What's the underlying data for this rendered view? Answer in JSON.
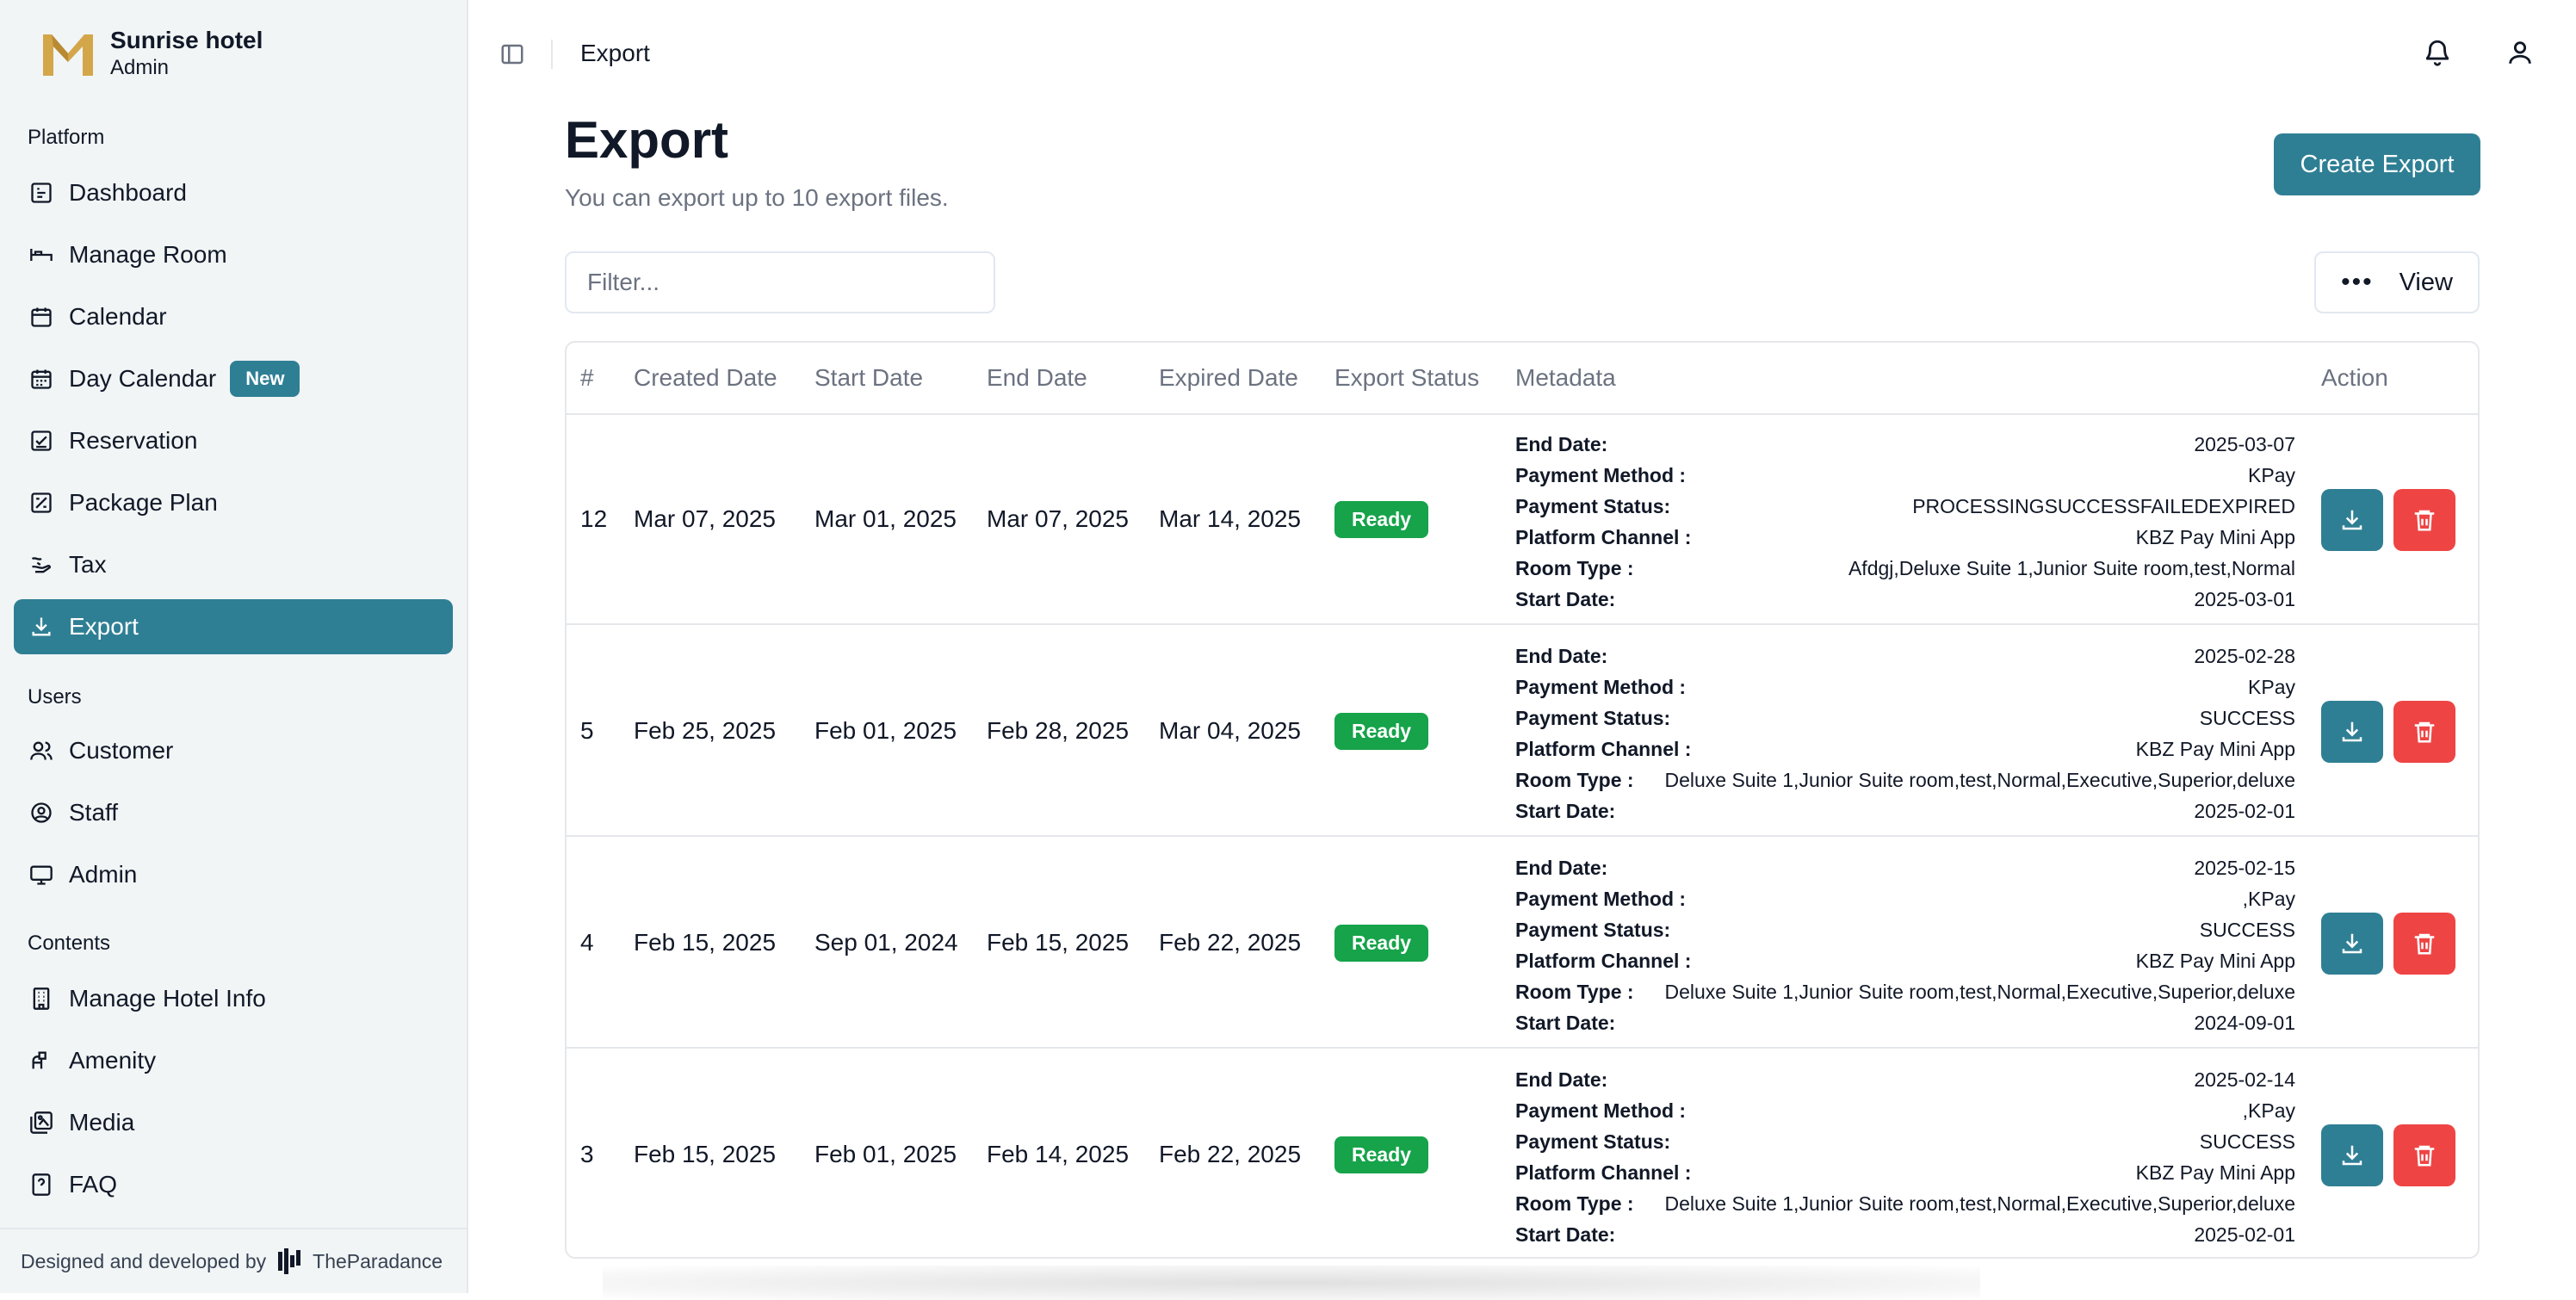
{
  "brand": {
    "title": "Sunrise hotel",
    "subtitle": "Admin"
  },
  "sidebar": {
    "groups": [
      {
        "label": "Platform"
      },
      {
        "label": "Users"
      },
      {
        "label": "Contents"
      }
    ],
    "items": [
      {
        "label": "Dashboard",
        "icon": "dashboard-icon"
      },
      {
        "label": "Manage Room",
        "icon": "bed-icon"
      },
      {
        "label": "Calendar",
        "icon": "calendar-icon"
      },
      {
        "label": "Day Calendar",
        "icon": "calendar-days-icon",
        "badge": "New"
      },
      {
        "label": "Reservation",
        "icon": "reservation-icon"
      },
      {
        "label": "Package Plan",
        "icon": "package-icon"
      },
      {
        "label": "Tax",
        "icon": "tax-icon"
      },
      {
        "label": "Export",
        "icon": "download-icon",
        "active": true
      },
      {
        "label": "Customer",
        "icon": "users-icon"
      },
      {
        "label": "Staff",
        "icon": "user-circle-icon"
      },
      {
        "label": "Admin",
        "icon": "monitor-icon"
      },
      {
        "label": "Manage Hotel Info",
        "icon": "building-icon"
      },
      {
        "label": "Amenity",
        "icon": "amenity-icon"
      },
      {
        "label": "Media",
        "icon": "media-icon"
      },
      {
        "label": "FAQ",
        "icon": "faq-icon"
      }
    ],
    "footer": {
      "text": "Designed and developed by",
      "company": "TheParadance"
    }
  },
  "topbar": {
    "breadcrumb": "Export"
  },
  "page": {
    "title": "Export",
    "subtitle": "You can export up to 10 export files.",
    "create_label": "Create Export",
    "filter_placeholder": "Filter...",
    "view_label": "View"
  },
  "table": {
    "headers": [
      "#",
      "Created Date",
      "Start Date",
      "End Date",
      "Expired Date",
      "Export Status",
      "Metadata",
      "Action"
    ],
    "meta_keys": [
      "End Date:",
      "Payment Method :",
      "Payment Status:",
      "Platform Channel :",
      "Room Type :",
      "Start Date:"
    ],
    "rows": [
      {
        "id": "12",
        "created": "Mar 07, 2025",
        "start": "Mar 01, 2025",
        "end": "Mar 07, 2025",
        "expired": "Mar 14, 2025",
        "status": "Ready",
        "meta": [
          "2025-03-07",
          "KPay",
          "PROCESSINGSUCCESSFAILEDEXPIRED",
          "KBZ Pay Mini App",
          "Afdgj,Deluxe Suite 1,Junior Suite room,test,Normal",
          "2025-03-01"
        ]
      },
      {
        "id": "5",
        "created": "Feb 25, 2025",
        "start": "Feb 01, 2025",
        "end": "Feb 28, 2025",
        "expired": "Mar 04, 2025",
        "status": "Ready",
        "meta": [
          "2025-02-28",
          "KPay",
          "SUCCESS",
          "KBZ Pay Mini App",
          "Deluxe Suite 1,Junior Suite room,test,Normal,Executive,Superior,deluxe",
          "2025-02-01"
        ]
      },
      {
        "id": "4",
        "created": "Feb 15, 2025",
        "start": "Sep 01, 2024",
        "end": "Feb 15, 2025",
        "expired": "Feb 22, 2025",
        "status": "Ready",
        "meta": [
          "2025-02-15",
          ",KPay",
          "SUCCESS",
          "KBZ Pay Mini App",
          "Deluxe Suite 1,Junior Suite room,test,Normal,Executive,Superior,deluxe",
          "2024-09-01"
        ]
      },
      {
        "id": "3",
        "created": "Feb 15, 2025",
        "start": "Feb 01, 2025",
        "end": "Feb 14, 2025",
        "expired": "Feb 22, 2025",
        "status": "Ready",
        "meta": [
          "2025-02-14",
          ",KPay",
          "SUCCESS",
          "KBZ Pay Mini App",
          "Deluxe Suite 1,Junior Suite room,test,Normal,Executive,Superior,deluxe",
          "2025-02-01"
        ]
      }
    ]
  },
  "colors": {
    "accent": "#2f7f94",
    "ready": "#16a34a",
    "danger": "#ef4444",
    "sidebar_bg": "#f1f5f6"
  }
}
